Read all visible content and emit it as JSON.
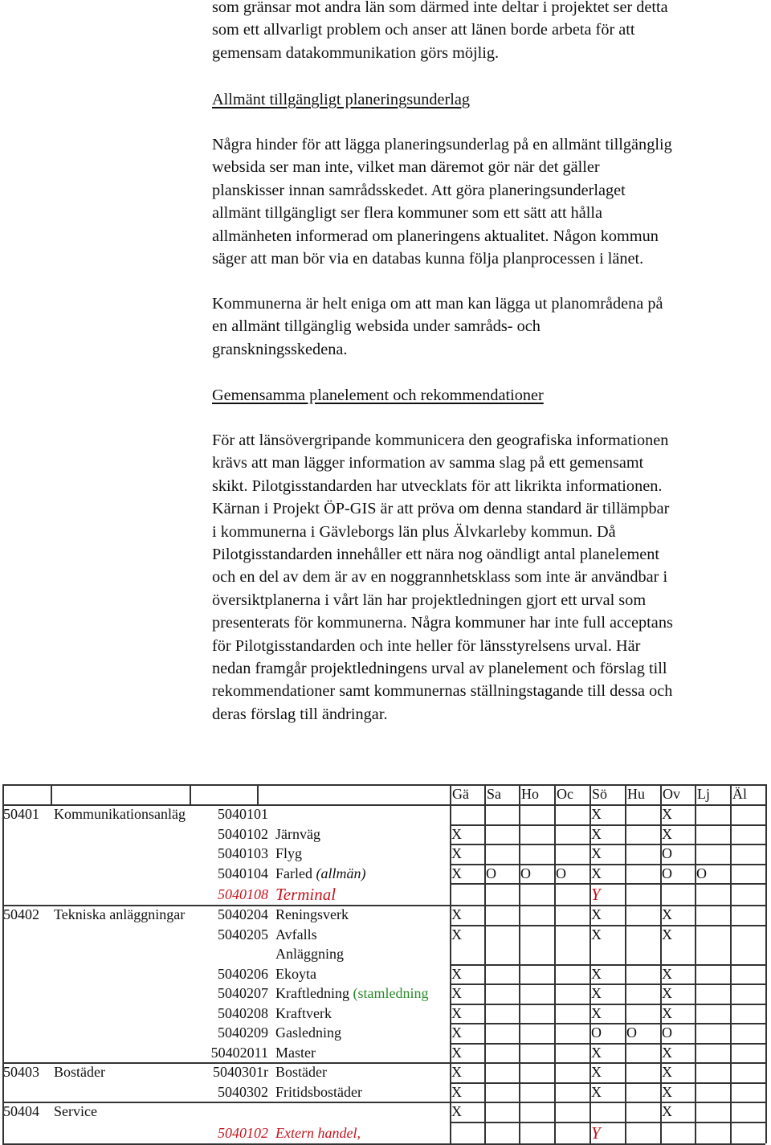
{
  "document": {
    "paragraphs": {
      "top": [
        "som gränsar mot andra län som därmed inte deltar i projektet ser detta",
        "som ett allvarligt problem och anser att länen borde arbeta för att",
        "gemensam datakommunikation görs möjlig."
      ],
      "heading_1": "Allmänt tillgängligt planeringsunderlag",
      "hinder": [
        "Några hinder för att lägga planeringsunderlag på en allmänt tillgänglig",
        "websida ser man inte, vilket man däremot gör när det gäller",
        "planskisser innan samrådsskedet. Att göra planeringsunderlaget",
        "allmänt tillgängligt ser flera kommuner som ett sätt att hålla",
        "allmänheten informerad om planeringens aktualitet. Någon kommun",
        "säger att man bör via en databas kunna följa planprocessen i länet."
      ],
      "kommun": [
        "Kommunerna är helt eniga om att man kan lägga ut planområdena på",
        "en allmänt tillgänglig websida under samråds- och",
        "granskningsskedena."
      ],
      "heading_2": "Gemensamma planelement och rekommendationer",
      "lans": [
        "För att länsövergripande kommunicera den geografiska informationen",
        "krävs att man lägger information av samma slag på ett gemensamt",
        "skikt. Pilotgisstandarden har utvecklats för att likrikta informationen.",
        "Kärnan i Projekt ÖP-GIS är att pröva om denna standard är tillämpbar",
        "i kommunerna i Gävleborgs län plus Älvkarleby kommun. Då",
        "Pilotgisstandarden innehåller ett nära nog oändligt antal planelement",
        "och en del av dem är av en noggrannhetsklass som inte är användbar i",
        "översiktplanerna i vårt län har projektledningen gjort ett urval som",
        "presenterats för kommunerna. Några kommuner har inte full acceptans",
        "för Pilotgisstandarden och inte heller för länsstyrelsens urval. Här",
        "nedan framgår projektledningens urval av planelement och förslag till",
        "rekommendationer samt kommunernas ställningstagande till dessa och",
        "deras förslag till ändringar."
      ]
    }
  },
  "table": {
    "columns": [
      "Gä",
      "Sa",
      "Ho",
      "Oc",
      "Sö",
      "Hu",
      "Ov",
      "Lj",
      "Äl"
    ],
    "colors": {
      "proposed": "#c8141e",
      "note": "#2a8a2a",
      "line": "#333333"
    },
    "rows": [
      {
        "group_code": "50401",
        "group_name": "Kommunikationsanläg",
        "code": "5040101",
        "name": "",
        "marks": [
          "",
          "",
          "",
          "",
          "X",
          "",
          "X",
          "",
          ""
        ]
      },
      {
        "group_code": "",
        "group_name": "",
        "code": "5040102",
        "name": "Järnväg",
        "marks": [
          "X",
          "",
          "",
          "",
          "X",
          "",
          "X",
          "",
          ""
        ]
      },
      {
        "group_code": "",
        "group_name": "",
        "code": "5040103",
        "name": "Flyg",
        "marks": [
          "X",
          "",
          "",
          "",
          "X",
          "",
          "O",
          "",
          ""
        ]
      },
      {
        "group_code": "",
        "group_name": "",
        "code": "5040104",
        "name": "Farled",
        "note": "(allmän)",
        "marks": [
          "X",
          "O",
          "O",
          "O",
          "X",
          "",
          "O",
          "O",
          ""
        ]
      },
      {
        "group_code": "",
        "group_name": "",
        "code": "5040108",
        "name": "Terminal",
        "style": "proposed",
        "marks": [
          "",
          "",
          "",
          "",
          "Y",
          "",
          "",
          "",
          ""
        ]
      },
      {
        "group_code": "50402",
        "group_name": "Tekniska anläggningar",
        "code": "5040204",
        "name": "Reningsverk",
        "marks": [
          "X",
          "",
          "",
          "",
          "X",
          "",
          "X",
          "",
          ""
        ]
      },
      {
        "group_code": "",
        "group_name": "",
        "code": "5040205",
        "name": "Avfalls",
        "name2": "Anläggning",
        "marks": [
          "X",
          "",
          "",
          "",
          "X",
          "",
          "X",
          "",
          ""
        ]
      },
      {
        "group_code": "",
        "group_name": "",
        "code": "5040206",
        "name": "Ekoyta",
        "marks": [
          "X",
          "",
          "",
          "",
          "X",
          "",
          "X",
          "",
          ""
        ]
      },
      {
        "group_code": "",
        "group_name": "",
        "code": "5040207",
        "name": "Kraftledning",
        "note": "(stamledning",
        "marks": [
          "X",
          "",
          "",
          "",
          "X",
          "",
          "X",
          "",
          ""
        ]
      },
      {
        "group_code": "",
        "group_name": "",
        "code": "5040208",
        "name": "Kraftverk",
        "marks": [
          "X",
          "",
          "",
          "",
          "X",
          "",
          "X",
          "",
          ""
        ]
      },
      {
        "group_code": "",
        "group_name": "",
        "code": "5040209",
        "name": "Gasledning",
        "marks": [
          "X",
          "",
          "",
          "",
          "O",
          "O",
          "O",
          "",
          ""
        ]
      },
      {
        "group_code": "",
        "group_name": "",
        "code": "50402011",
        "name": "Master",
        "marks": [
          "X",
          "",
          "",
          "",
          "X",
          "",
          "X",
          "",
          ""
        ]
      },
      {
        "group_code": "50403",
        "group_name": "Bostäder",
        "code": "5040301r",
        "name": "Bostäder",
        "marks": [
          "X",
          "",
          "",
          "",
          "X",
          "",
          "X",
          "",
          ""
        ]
      },
      {
        "group_code": "",
        "group_name": "",
        "code": "5040302",
        "name": "Fritidsbostäder",
        "marks": [
          "X",
          "",
          "",
          "",
          "X",
          "",
          "X",
          "",
          ""
        ]
      },
      {
        "group_code": "50404",
        "group_name": "Service",
        "code": "",
        "name": "",
        "marks": [
          "X",
          "",
          "",
          "",
          "",
          "",
          "X",
          "",
          ""
        ]
      },
      {
        "group_code": "",
        "group_name": "",
        "code": "5040102",
        "name": "Extern handel,",
        "style": "proposed",
        "marks": [
          "",
          "",
          "",
          "",
          "Y",
          "",
          "",
          "",
          ""
        ]
      }
    ]
  }
}
